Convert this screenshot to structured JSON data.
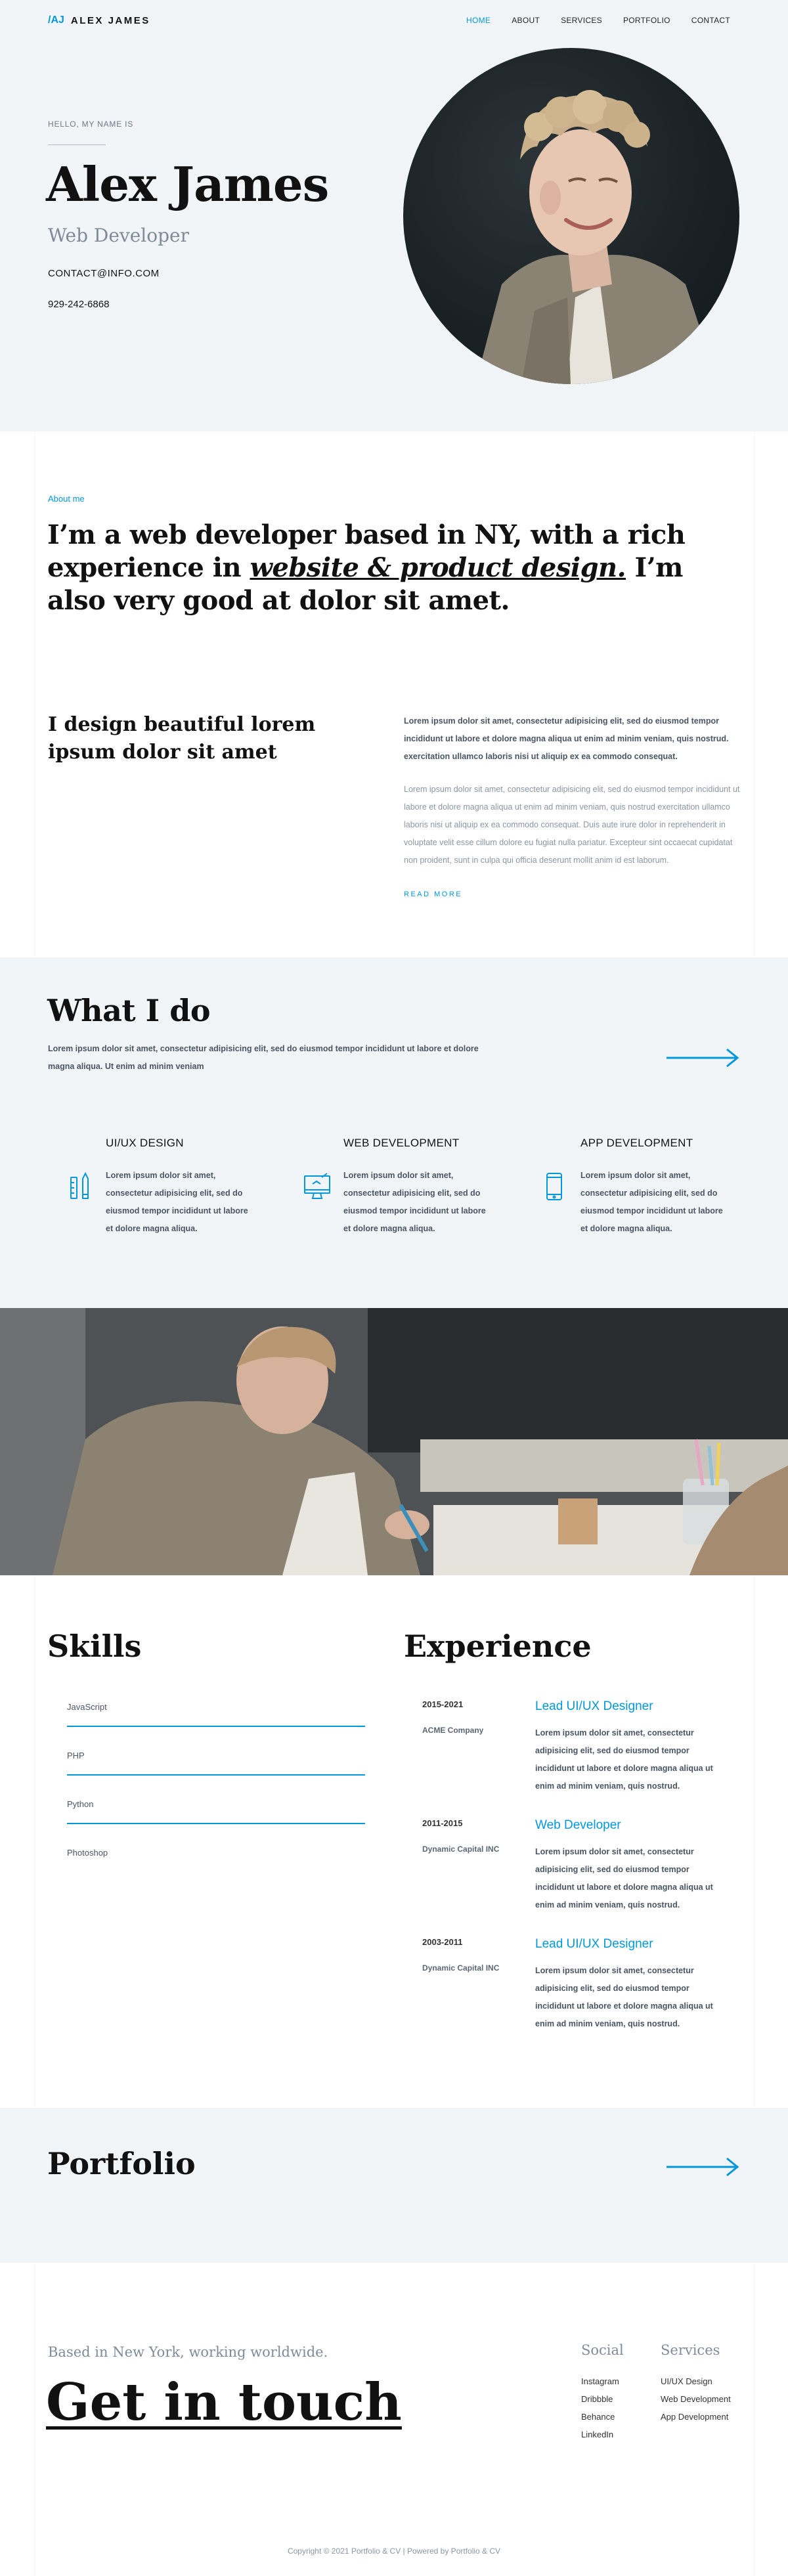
{
  "nav": {
    "logo_mark": "/AJ",
    "logo_text": "ALEX JAMES",
    "links": [
      "HOME",
      "ABOUT",
      "SERVICES",
      "PORTFOLIO",
      "CONTACT"
    ]
  },
  "hero": {
    "greeting": "HELLO, MY NAME IS",
    "name": "Alex James",
    "role": "Web Developer",
    "email": "CONTACT@INFO.COM",
    "phone": "929-242-6868"
  },
  "about": {
    "label": "About me",
    "heading_part1": "I’m a web developer based in NY, with a rich experience in ",
    "heading_emph": "website & product design.",
    "heading_part2": " I’m also very good at dolor sit amet.",
    "subheading": "I design beautiful lorem ipsum dolor sit amet",
    "paragraph1": "Lorem ipsum dolor sit amet, consectetur adipisicing elit, sed do eiusmod tempor incididunt ut labore et dolore magna aliqua ut enim ad minim veniam, quis nostrud. exercitation ullamco laboris nisi ut aliquip ex ea commodo consequat.",
    "paragraph2": "Lorem ipsum dolor sit amet, consectetur adipisicing elit, sed do eiusmod tempor incididunt ut labore et dolore magna aliqua ut enim ad minim veniam, quis nostrud exercitation ullamco laboris nisi ut aliquip ex ea commodo consequat. Duis aute irure dolor in reprehenderit in voluptate velit esse cillum dolore eu fugiat nulla pariatur. Excepteur sint occaecat cupidatat non proident, sunt in culpa qui officia deserunt mollit anim id est laborum.",
    "read_more": "READ MORE"
  },
  "services": {
    "title": "What I do",
    "description": "Lorem ipsum dolor sit amet, consectetur adipisicing elit, sed do eiusmod tempor incididunt ut labore et dolore magna aliqua. Ut enim ad minim veniam",
    "items": [
      {
        "title": "UI/UX DESIGN",
        "icon": "pencil-ruler-icon",
        "text": "Lorem ipsum dolor sit amet, consectetur adipisicing elit, sed do eiusmod tempor incididunt ut labore et dolore magna aliqua."
      },
      {
        "title": "WEB DEVELOPMENT",
        "icon": "monitor-icon",
        "text": "Lorem ipsum dolor sit amet, consectetur adipisicing elit, sed do eiusmod tempor incididunt ut labore et dolore magna aliqua."
      },
      {
        "title": "APP DEVELOPMENT",
        "icon": "smartphone-icon",
        "text": "Lorem ipsum dolor sit amet, consectetur adipisicing elit, sed do eiusmod tempor incididunt ut labore et dolore magna aliqua."
      }
    ]
  },
  "skills": {
    "title": "Skills",
    "items": [
      {
        "name": "JavaScript",
        "level": 1.0
      },
      {
        "name": "PHP",
        "level": 1.0
      },
      {
        "name": "Python",
        "level": 1.0
      },
      {
        "name": "Photoshop",
        "level": 0
      }
    ]
  },
  "experience": {
    "title": "Experience",
    "items": [
      {
        "years": "2015-2021",
        "company": "ACME Company",
        "role": "Lead UI/UX Designer",
        "desc": "Lorem ipsum dolor sit amet, consectetur adipisicing elit, sed do eiusmod tempor incididunt ut labore et dolore magna aliqua ut enim ad minim veniam, quis nostrud."
      },
      {
        "years": "2011-2015",
        "company": "Dynamic Capital INC",
        "role": "Web Developer",
        "desc": "Lorem ipsum dolor sit amet, consectetur adipisicing elit, sed do eiusmod tempor incididunt ut labore et dolore magna aliqua ut enim ad minim veniam, quis nostrud."
      },
      {
        "years": "2003-2011",
        "company": "Dynamic Capital INC",
        "role": "Lead UI/UX Designer",
        "desc": "Lorem ipsum dolor sit amet, consectetur adipisicing elit, sed do eiusmod tempor incididunt ut labore et dolore magna aliqua ut enim ad minim veniam, quis nostrud."
      }
    ]
  },
  "portfolio": {
    "title": "Portfolio"
  },
  "contact": {
    "tagline": "Based in New York, working worldwide.",
    "title": "Get in touch"
  },
  "footer": {
    "social_title": "Social",
    "social_links": [
      "Instagram",
      "Dribbble",
      "Behance",
      "LinkedIn"
    ],
    "services_title": "Services",
    "services_links": [
      "UI/UX Design",
      "Web Development",
      "App Development"
    ],
    "copyright": "Copyright © 2021 Portfolio & CV | Powered by Portfolio & CV"
  },
  "colors": {
    "accent": "#0098da",
    "section_bg": "#f2f5f8"
  }
}
